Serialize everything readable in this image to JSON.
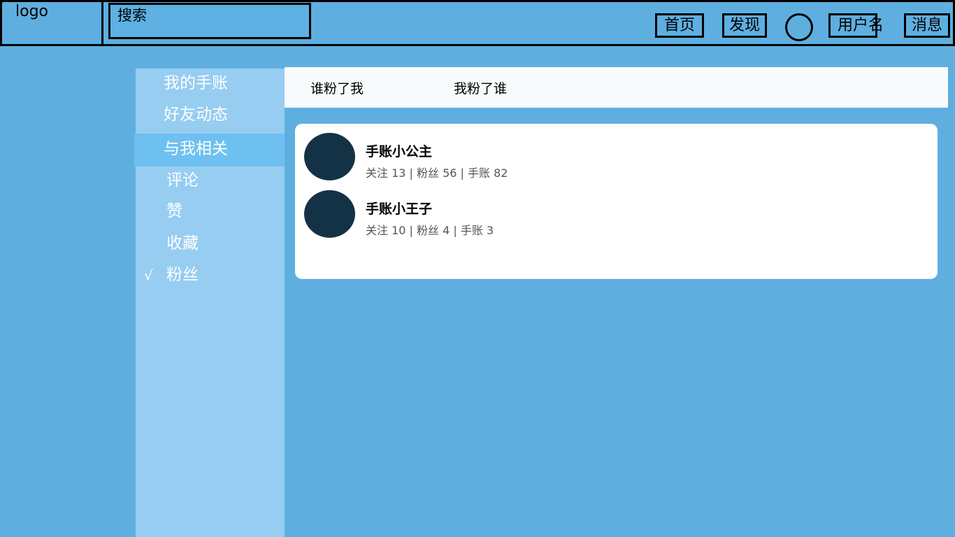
{
  "header": {
    "logo": "logo",
    "search_placeholder": "搜索",
    "nav": {
      "home": "首页",
      "discover": "发现",
      "username": "用户名",
      "messages": "消息"
    }
  },
  "sidebar": {
    "items": [
      {
        "label": "我的手账"
      },
      {
        "label": "好友动态"
      },
      {
        "label": "与我相关"
      },
      {
        "label": "评论"
      },
      {
        "label": "赞"
      },
      {
        "label": "收藏"
      },
      {
        "label": "粉丝"
      }
    ],
    "active_mark": "√"
  },
  "tabs": [
    {
      "label": "谁粉了我"
    },
    {
      "label": "我粉了谁"
    }
  ],
  "users": [
    {
      "name": "手账小公主",
      "stats": "关注 13 | 粉丝 56 | 手账 82"
    },
    {
      "name": "手账小王子",
      "stats": "关注 10 | 粉丝 4 | 手账 3"
    }
  ],
  "colors": {
    "background": "#5eafe0",
    "sidebar": "#96cdf1",
    "sidebar_active": "#6ec0f0",
    "avatar": "#143246"
  }
}
